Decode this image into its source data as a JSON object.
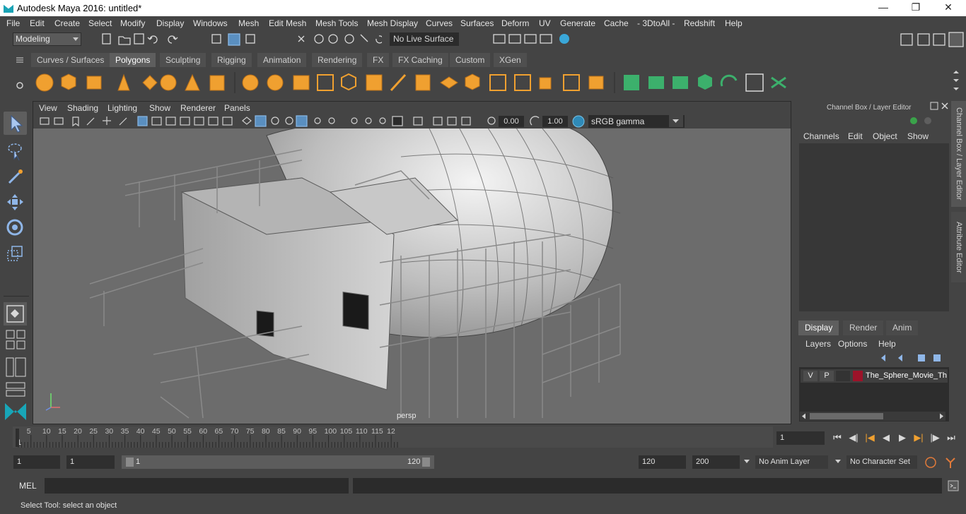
{
  "window": {
    "title": "Autodesk Maya 2016: untitled*"
  },
  "menubar": {
    "items": [
      "File",
      "Edit",
      "Create",
      "Select",
      "Modify",
      "Display",
      "Windows",
      "Mesh",
      "Edit Mesh",
      "Mesh Tools",
      "Mesh Display",
      "Curves",
      "Surfaces",
      "Deform",
      "UV",
      "Generate",
      "Cache",
      "- 3DtoAll -",
      "Redshift",
      "Help"
    ]
  },
  "statusline": {
    "mode": "Modeling",
    "live_surface": "No Live Surface"
  },
  "shelf": {
    "tabs": [
      "Curves / Surfaces",
      "Polygons",
      "Sculpting",
      "Rigging",
      "Animation",
      "Rendering",
      "FX",
      "FX Caching",
      "Custom",
      "XGen"
    ],
    "active_tab": "Polygons"
  },
  "viewport": {
    "menu": [
      "View",
      "Shading",
      "Lighting",
      "Show",
      "Renderer",
      "Panels"
    ],
    "exposure": "0.00",
    "gamma": "1.00",
    "color_space": "sRGB gamma",
    "camera_label": "persp"
  },
  "channel_box": {
    "title": "Channel Box / Layer Editor",
    "menu": [
      "Channels",
      "Edit",
      "Object",
      "Show"
    ]
  },
  "layer_editor": {
    "tabs": [
      "Display",
      "Render",
      "Anim"
    ],
    "active_tab": "Display",
    "menu": [
      "Layers",
      "Options",
      "Help"
    ],
    "layer": {
      "v": "V",
      "p": "P",
      "name": "The_Sphere_Movie_Th",
      "color": "#9c1329"
    }
  },
  "side_tabs": [
    "Channel Box / Layer Editor",
    "Attribute Editor"
  ],
  "timeline": {
    "ticks": [
      "5",
      "10",
      "15",
      "20",
      "25",
      "30",
      "35",
      "40",
      "45",
      "50",
      "55",
      "60",
      "65",
      "70",
      "75",
      "80",
      "85",
      "90",
      "95",
      "100",
      "105",
      "110",
      "115",
      "12"
    ],
    "first_tick": "1",
    "current_frame": "1"
  },
  "range": {
    "start": "1",
    "playback_start": "1",
    "range_start_label": "1",
    "range_end_label": "120",
    "playback_end": "120",
    "end": "200",
    "anim_layer": "No Anim Layer",
    "character_set": "No Character Set"
  },
  "command_line": {
    "label": "MEL"
  },
  "help_line": {
    "text": "Select Tool: select an object"
  }
}
